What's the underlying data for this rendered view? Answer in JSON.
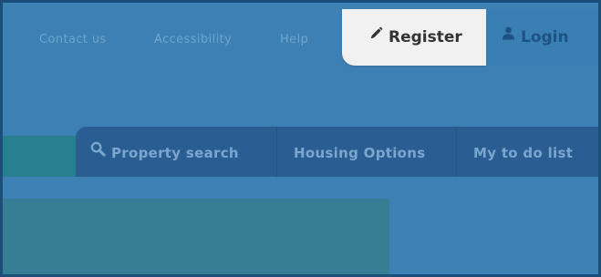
{
  "top_links": {
    "contact": "Contact us",
    "accessibility": "Accessibility",
    "help": "Help"
  },
  "account": {
    "register_label": "Register",
    "login_label": "Login"
  },
  "nav": {
    "property_search": "Property search",
    "housing_options": "Housing Options",
    "todo": "My to do list"
  },
  "icons": {
    "register": "pencil-icon",
    "login": "user-icon",
    "property_search": "search-icon"
  },
  "colors": {
    "background": "#3d80b4",
    "nav_bar": "#2a5e92",
    "register_bg": "#f1f1f1",
    "teal_accent": "#28808f"
  }
}
